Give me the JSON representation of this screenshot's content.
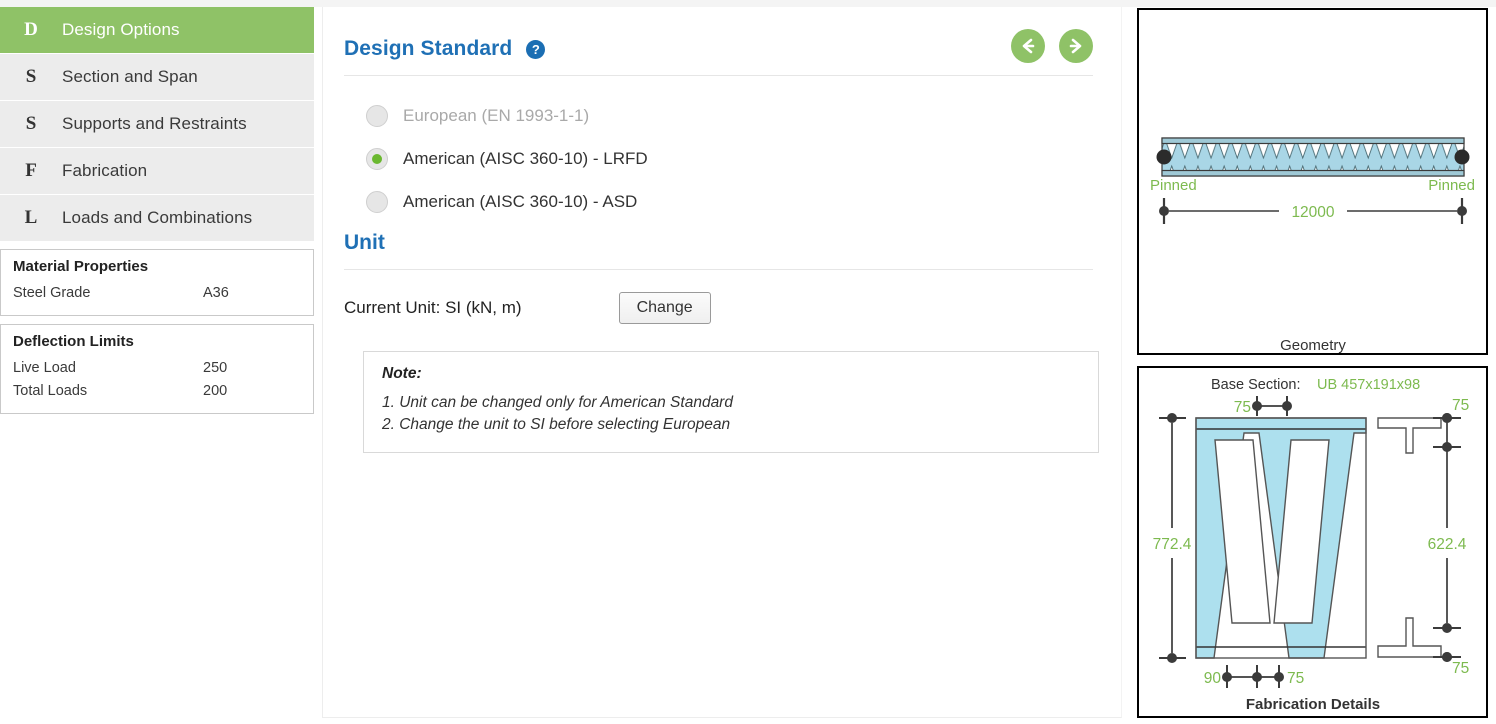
{
  "sidebar": {
    "nav_items": [
      {
        "key": "D",
        "label": "Design Options",
        "active": true
      },
      {
        "key": "S",
        "label": "Section and Span",
        "active": false
      },
      {
        "key": "S",
        "label": "Supports and Restraints",
        "active": false
      },
      {
        "key": "F",
        "label": "Fabrication",
        "active": false
      },
      {
        "key": "L",
        "label": "Loads and Combinations",
        "active": false
      }
    ],
    "material_properties": {
      "title": "Material Properties",
      "rows": [
        {
          "key": "Steel Grade",
          "value": "A36"
        }
      ]
    },
    "deflection_limits": {
      "title": "Deflection Limits",
      "rows": [
        {
          "key": "Live Load",
          "value": "250"
        },
        {
          "key": "Total Loads",
          "value": "200"
        }
      ]
    }
  },
  "main": {
    "design_standard": {
      "title": "Design Standard",
      "help_icon": "question-mark-icon",
      "help_glyph": "?",
      "options": [
        {
          "label": "European (EN 1993-1-1)",
          "selected": false,
          "disabled": true
        },
        {
          "label": "American (AISC 360-10) - LRFD",
          "selected": true,
          "disabled": false
        },
        {
          "label": "American (AISC 360-10) - ASD",
          "selected": false,
          "disabled": false
        }
      ]
    },
    "unit": {
      "title": "Unit",
      "current_label": "Current Unit: SI (kN, m)",
      "change_button": "Change"
    },
    "note": {
      "title": "Note:",
      "lines": [
        "1. Unit can be changed only for American Standard",
        "2. Change the unit to SI before selecting European"
      ]
    },
    "nav_prev_icon": "arrow-left-circle-icon",
    "nav_next_icon": "arrow-right-circle-icon"
  },
  "geometry": {
    "caption": "Geometry",
    "support_left": "Pinned",
    "support_right": "Pinned",
    "span": "12000"
  },
  "fabrication": {
    "caption": "Fabrication Details",
    "base_section_label": "Base Section:",
    "base_section_value": "UB 457x191x98",
    "dim_top_spacing": "75",
    "dim_right_top": "75",
    "dim_right_bottom": "75",
    "dim_left_depth": "772.4",
    "dim_right_depth": "622.4",
    "dim_bottom_left": "90",
    "dim_bottom_right": "75"
  },
  "colors": {
    "accent_green": "#8fc267",
    "heading_blue": "#1f70b5",
    "dim_green": "#7dba4f",
    "section_fill": "#ade0ee",
    "sidebar_item_bg": "#ececec"
  }
}
